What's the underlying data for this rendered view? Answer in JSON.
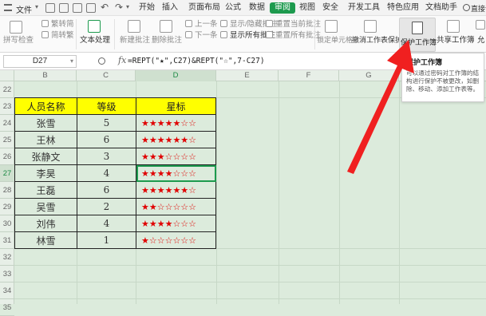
{
  "menubar": {
    "file_menu": "文件",
    "tabs": [
      "开始",
      "插入",
      "页面布局",
      "公式",
      "数据",
      "审阅",
      "视图",
      "安全",
      "开发工具",
      "特色应用",
      "文档助手"
    ],
    "active_tab": "审阅",
    "right_label": "直接访问"
  },
  "ribbon": {
    "spell_check": "拼写检查",
    "trad_to_simp": "繁转简",
    "simp_to_trad": "简转繁",
    "text_processing": "文本处理",
    "new_comment": "新建批注",
    "delete_comment": "删除批注",
    "prev_comment": "上一条",
    "next_comment": "下一条",
    "show_comments": "显示/隐藏批注",
    "show_all_comments": "显示所有批注",
    "reset_current_comment": "重置当前批注",
    "reset_all_comments": "重置所有批注",
    "lock_cell": "锁定单元格",
    "unprotect_sheet": "撤消工作表保护",
    "protect_workbook": "保护工作簿",
    "share_workbook": "共享工作簿",
    "allow_user_edit": "允"
  },
  "formula_bar": {
    "name_box": "D27",
    "fx": "fx",
    "formula": "=REPT(\"★\",C27)&REPT(\"☆\",7-C27)"
  },
  "columns": [
    "B",
    "C",
    "D",
    "E",
    "F",
    "G"
  ],
  "selected_column": "D",
  "rows": [
    "22",
    "23",
    "24",
    "25",
    "26",
    "27",
    "28",
    "29",
    "30",
    "31",
    "32",
    "33",
    "34",
    "35"
  ],
  "selected_row": "27",
  "table": {
    "headers": [
      "人员名称",
      "等级",
      "星标"
    ],
    "rows": [
      {
        "name": "张雪",
        "level": "5",
        "stars": "★★★★★☆☆"
      },
      {
        "name": "王林",
        "level": "6",
        "stars": "★★★★★★☆"
      },
      {
        "name": "张静文",
        "level": "3",
        "stars": "★★★☆☆☆☆"
      },
      {
        "name": "李昊",
        "level": "4",
        "stars": "★★★★☆☆☆"
      },
      {
        "name": "王磊",
        "level": "6",
        "stars": "★★★★★★☆"
      },
      {
        "name": "吴雪",
        "level": "2",
        "stars": "★★☆☆☆☆☆"
      },
      {
        "name": "刘伟",
        "level": "4",
        "stars": "★★★★☆☆☆"
      },
      {
        "name": "林雪",
        "level": "1",
        "stars": "★☆☆☆☆☆☆"
      }
    ],
    "header_color": "#ffff00",
    "star_color": "#e00000"
  },
  "tooltip": {
    "title": "保护工作簿",
    "body": "可以通过密码对工作簿的结构进行保护不被更改，如删除、移动、添加工作表等。"
  },
  "colors": {
    "accent": "#1d9a4e",
    "grid_bg": "#dcebdc",
    "arrow": "#f02020"
  },
  "icons": [
    "undo-icon",
    "redo-icon",
    "save-icon",
    "print-icon",
    "spellcheck-icon",
    "comment-icon",
    "lock-icon",
    "protect-workbook-icon",
    "share-icon",
    "magnifier-icon",
    "fx-icon",
    "red-arrow"
  ]
}
